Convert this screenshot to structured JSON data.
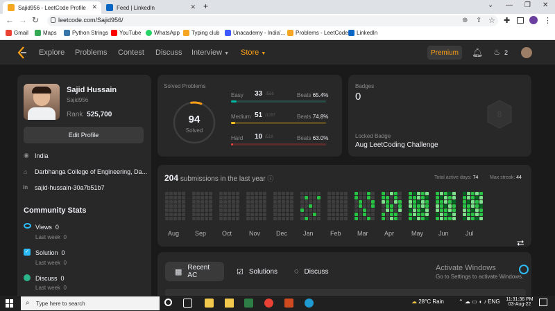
{
  "browser": {
    "tabs": [
      {
        "title": "Sajid956 - LeetCode Profile",
        "active": true
      },
      {
        "title": "Feed | LinkedIn",
        "active": false
      }
    ],
    "url": "leetcode.com/Sajid956/",
    "bookmarks": [
      "Gmail",
      "Maps",
      "Python Strings",
      "YouTube",
      "WhatsApp",
      "Typing club",
      "Unacademy - India'...",
      "Problems - LeetCode",
      "LinkedIn"
    ]
  },
  "nav": {
    "links": [
      "Explore",
      "Problems",
      "Contest",
      "Discuss",
      "Interview",
      "Store"
    ],
    "premium": "Premium",
    "streak": "2"
  },
  "profile": {
    "name": "Sajid Hussain",
    "username": "Sajid956",
    "rank_label": "Rank",
    "rank_value": "525,700",
    "edit_label": "Edit Profile",
    "location": "India",
    "school": "Darbhanga College of Engineering, Da...",
    "linkedin": "sajid-hussain-30a7b51b7"
  },
  "community": {
    "title": "Community Stats",
    "items": [
      {
        "label": "Views",
        "value": "0",
        "sub": "Last week",
        "sub_value": "0"
      },
      {
        "label": "Solution",
        "value": "0",
        "sub": "Last week",
        "sub_value": "0"
      },
      {
        "label": "Discuss",
        "value": "0",
        "sub": "Last week",
        "sub_value": "0"
      }
    ]
  },
  "solved": {
    "title": "Solved Problems",
    "total": "94",
    "total_label": "Solved",
    "rows": [
      {
        "label": "Easy",
        "count": "33",
        "of": "/586",
        "beats_label": "Beats",
        "beats": "65.4%",
        "fraction": 0.056,
        "color": "#00b8a3"
      },
      {
        "label": "Medium",
        "count": "51",
        "of": "/1257",
        "beats_label": "Beats",
        "beats": "74.8%",
        "fraction": 0.041,
        "color": "#ffc01e"
      },
      {
        "label": "Hard",
        "count": "10",
        "of": "/518",
        "beats_label": "Beats",
        "beats": "63.0%",
        "fraction": 0.019,
        "color": "#ef4743"
      }
    ]
  },
  "badges": {
    "title": "Badges",
    "count": "0",
    "locked_label": "Locked Badge",
    "locked_name": "Aug LeetCoding Challenge"
  },
  "submissions": {
    "count": "204",
    "text": "submissions in the last year",
    "active_label": "Total active days:",
    "active_value": "74",
    "streak_label": "Max streak:",
    "streak_value": "44",
    "months": [
      "Aug",
      "Sep",
      "Oct",
      "Nov",
      "Dec",
      "Jan",
      "Feb",
      "Mar",
      "Apr",
      "May",
      "Jun",
      "Jul"
    ]
  },
  "recent": {
    "tabs": [
      "Recent AC",
      "Solutions",
      "Discuss"
    ]
  },
  "watermark": {
    "line1": "Activate Windows",
    "line2": "Go to Settings to activate Windows."
  },
  "taskbar": {
    "search": "Type here to search",
    "weather": "28°C  Rain",
    "time": "11:31:36 PM",
    "date": "03-Aug-22"
  },
  "colors": {
    "accent": "#ffa116",
    "easy": "#00b8a3",
    "medium": "#ffc01e",
    "hard": "#ef4743",
    "heat_low": "#016620",
    "heat_mid": "#28c244",
    "heat_high": "#7fe18b"
  }
}
